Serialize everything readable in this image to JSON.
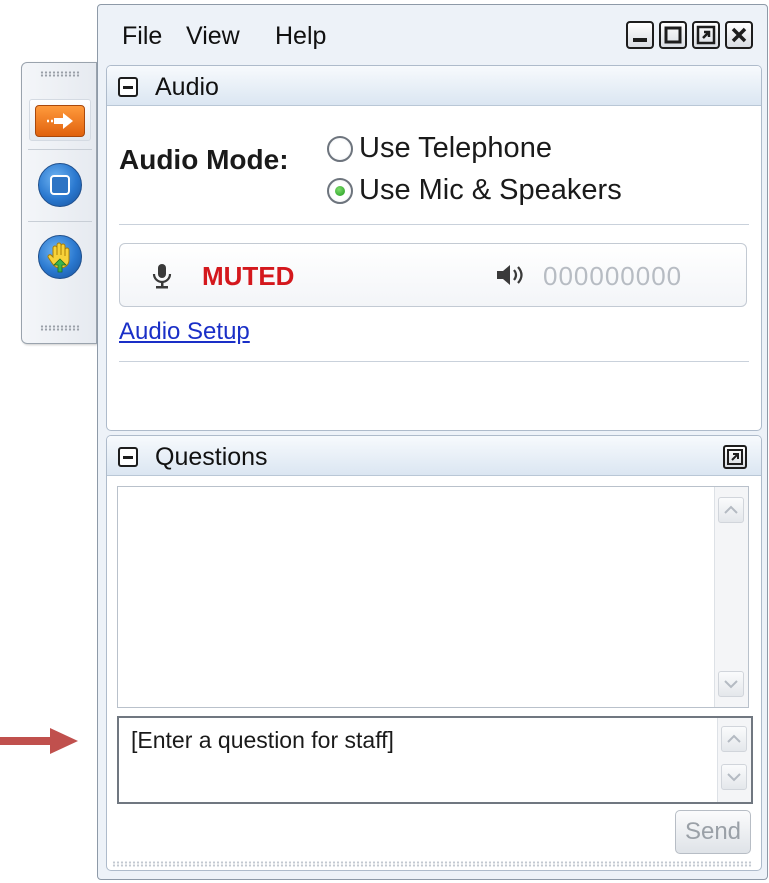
{
  "menubar": {
    "items": [
      "File",
      "View",
      "Help"
    ]
  },
  "audio_panel": {
    "title": "Audio",
    "mode_label": "Audio Mode:",
    "options": [
      {
        "label": "Use Telephone",
        "selected": false
      },
      {
        "label": "Use Mic & Speakers",
        "selected": true
      }
    ],
    "mic_status": "MUTED",
    "speaker_level": "000000000",
    "setup_link": "Audio Setup"
  },
  "questions_panel": {
    "title": "Questions",
    "input_text": "[Enter a question for staff]",
    "send_label": "Send"
  },
  "side_toolbar": {
    "buttons": [
      "arrow-right-icon",
      "stop-icon",
      "raise-hand-icon"
    ]
  },
  "colors": {
    "muted": "#d4181d",
    "link": "#1a2fc7",
    "annotation_arrow": "#c0504d",
    "radio_selected": "#1f9a20",
    "toolbar_orange": "#e0620e",
    "toolbar_blue": "#2a78cf"
  }
}
